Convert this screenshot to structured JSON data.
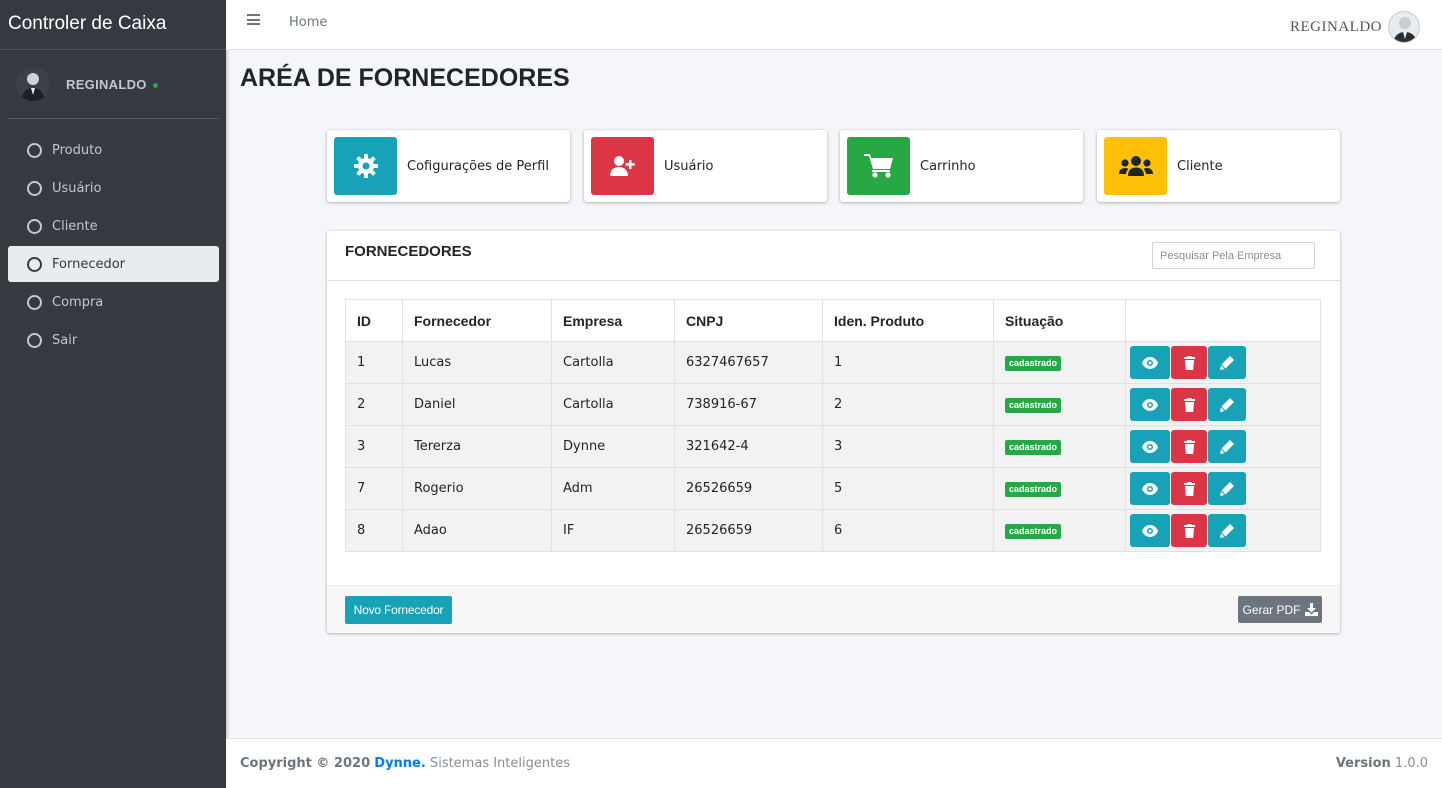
{
  "app": {
    "brand": "Controler de Caixa"
  },
  "user": {
    "name": "REGINALDO",
    "status_color": "#28a745"
  },
  "sidebar": {
    "items": [
      {
        "label": "Produto",
        "active": false
      },
      {
        "label": "Usuário",
        "active": false
      },
      {
        "label": "Cliente",
        "active": false
      },
      {
        "label": "Fornecedor",
        "active": true
      },
      {
        "label": "Compra",
        "active": false
      },
      {
        "label": "Sair",
        "active": false
      }
    ]
  },
  "topbar": {
    "home_label": "Home",
    "user_name": "REGINALDO"
  },
  "page": {
    "title": "ARÉA DE FORNECEDORES"
  },
  "info_boxes": [
    {
      "label": "Cofigurações de Perfil",
      "icon": "gear-icon",
      "color": "#17a2b8"
    },
    {
      "label": "Usuário",
      "icon": "user-plus-icon",
      "color": "#dc3545"
    },
    {
      "label": "Carrinho",
      "icon": "cart-icon",
      "color": "#28a745"
    },
    {
      "label": "Cliente",
      "icon": "users-icon",
      "color": "#ffc107"
    }
  ],
  "suppliers": {
    "title": "FORNECEDORES",
    "search_placeholder": "Pesquisar Pela Empresa",
    "columns": [
      "ID",
      "Fornecedor",
      "Empresa",
      "CNPJ",
      "Iden. Produto",
      "Situação",
      ""
    ],
    "rows": [
      {
        "id": "1",
        "fornecedor": "Lucas",
        "empresa": "Cartolla",
        "cnpj": "6327467657",
        "produto": "1",
        "situacao": "cadastrado"
      },
      {
        "id": "2",
        "fornecedor": "Daniel",
        "empresa": "Cartolla",
        "cnpj": "738916-67",
        "produto": "2",
        "situacao": "cadastrado"
      },
      {
        "id": "3",
        "fornecedor": "Tererza",
        "empresa": "Dynne",
        "cnpj": "321642-4",
        "produto": "3",
        "situacao": "cadastrado"
      },
      {
        "id": "7",
        "fornecedor": "Rogerio",
        "empresa": "Adm",
        "cnpj": "26526659",
        "produto": "5",
        "situacao": "cadastrado"
      },
      {
        "id": "8",
        "fornecedor": "Adao",
        "empresa": "IF",
        "cnpj": "26526659",
        "produto": "6",
        "situacao": "cadastrado"
      }
    ],
    "new_button": "Novo Fornecedor",
    "pdf_button": "Gerar PDF"
  },
  "footer": {
    "copyright": "Copyright © 2020",
    "company": "Dynne.",
    "tagline": "Sistemas Inteligentes",
    "version_label": "Version",
    "version": "1.0.0"
  }
}
